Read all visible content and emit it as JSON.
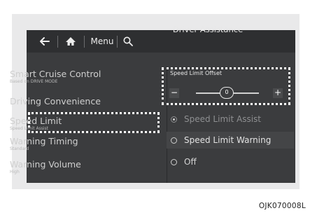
{
  "toolbar": {
    "menu_label": "Menu"
  },
  "page_title": "Driver Assistance",
  "left_menu": [
    {
      "label": "Smart Cruise Control",
      "sub": "Based on DRIVE MODE"
    },
    {
      "label": "Driving Convenience",
      "sub": ""
    },
    {
      "label": "Speed Limit",
      "sub": "Speed Limit Assist"
    },
    {
      "label": "Warning Timing",
      "sub": "Standard"
    },
    {
      "label": "Warning Volume",
      "sub": "High"
    }
  ],
  "offset": {
    "label": "Speed Limit Offset",
    "value": "0",
    "minus": "−",
    "plus": "+"
  },
  "options": [
    {
      "label": "Speed Limit Assist",
      "selected": true
    },
    {
      "label": "Speed Limit Warning",
      "selected": false
    },
    {
      "label": "Off",
      "selected": false
    }
  ],
  "caption": "OJK070008L",
  "colors": {
    "screen_bg": "#3b3c3e",
    "topbar_bg": "#2e2f31",
    "highlight": "#ffffff",
    "frame_bg": "#e9e9ea"
  },
  "icons": [
    "back-arrow-icon",
    "home-icon",
    "search-icon",
    "radio-icon"
  ]
}
